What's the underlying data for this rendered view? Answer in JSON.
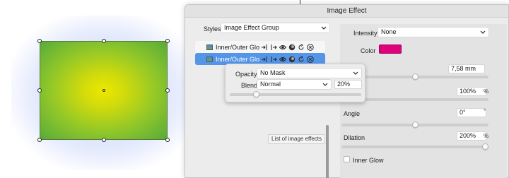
{
  "dialog": {
    "title": "Image Effect",
    "styles_label": "Styles",
    "styles_value": "Image Effect Group"
  },
  "effects": [
    {
      "name": "Inner/Outer Glow",
      "selected": false
    },
    {
      "name": "Inner/Outer Glow",
      "selected": true
    }
  ],
  "effect_row_icons": [
    "insert-icon",
    "extract-icon",
    "visibility-eye-icon",
    "mask-icon",
    "reset-icon",
    "remove-icon"
  ],
  "tooltip": "List of image effects",
  "popover": {
    "opacity_label": "Opacity",
    "opacity_value": "No Mask",
    "blend_label": "Blend",
    "blend_value": "Normal",
    "blend_percent": "20%",
    "blend_slider_fraction": 0.2
  },
  "properties": {
    "intensity_label": "Intensity",
    "intensity_value": "None",
    "color_label": "Color",
    "color_hex": "#e0007a",
    "radius_value": "7,58 mm",
    "radius_slider_fraction": 0.5,
    "opacity_value": "100%",
    "opacity_unit": "%",
    "opacity_slider_fraction": 1.0,
    "angle_label": "Angle",
    "angle_value": "0°",
    "angle_unit": "°",
    "angle_slider_fraction": 0.5,
    "dilation_label": "Dilation",
    "dilation_value": "200%",
    "dilation_unit": "%",
    "dilation_slider_fraction": 1.0,
    "inner_glow_label": "Inner Glow",
    "inner_glow_checked": false
  },
  "colors": {
    "selection_blue": "#5495e8",
    "swatch": "#e0007a"
  }
}
